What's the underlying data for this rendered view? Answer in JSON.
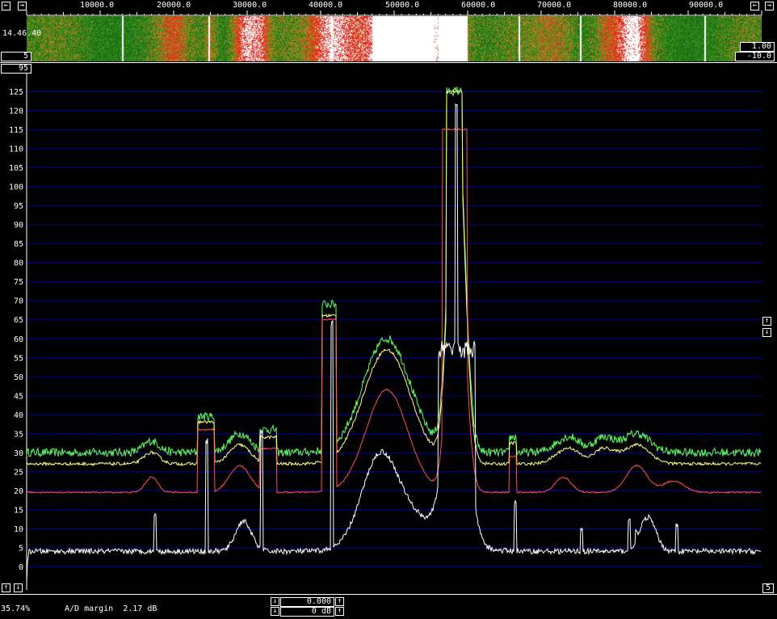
{
  "waterfall": {
    "freq_labels": [
      "10000.0",
      "20000.0",
      "30000.0",
      "40000.0",
      "50000.0",
      "60000.0",
      "70000.0",
      "80000.0",
      "90000.0"
    ],
    "time_label": "14.46.40",
    "left_bottom_value": "5",
    "right_value_1": "1.00",
    "right_value_2": "-10.0"
  },
  "spectrum": {
    "top_box_value": "95",
    "y_ticks": [
      "125",
      "120",
      "115",
      "110",
      "105",
      "100",
      "95",
      "90",
      "85",
      "80",
      "75",
      "70",
      "65",
      "60",
      "55",
      "50",
      "45",
      "40",
      "35",
      "30",
      "25",
      "20",
      "15",
      "10",
      "5",
      "0"
    ],
    "right_bottom_value": "5",
    "colors": {
      "green": "#5cff5c",
      "yellow": "#ffff80",
      "red": "#ff5050",
      "pink": "#ff66cc",
      "white": "#ffffff",
      "grid": "#0000a8"
    }
  },
  "status": {
    "percent": "35.74%",
    "ad_margin": "A/D margin  2.17 dB",
    "gain_value": "0.000",
    "db_value": "0 dB"
  },
  "icons": {
    "left_arrow": "←",
    "right_arrow": "→",
    "up_arrow": "↑",
    "down_arrow": "↓"
  }
}
